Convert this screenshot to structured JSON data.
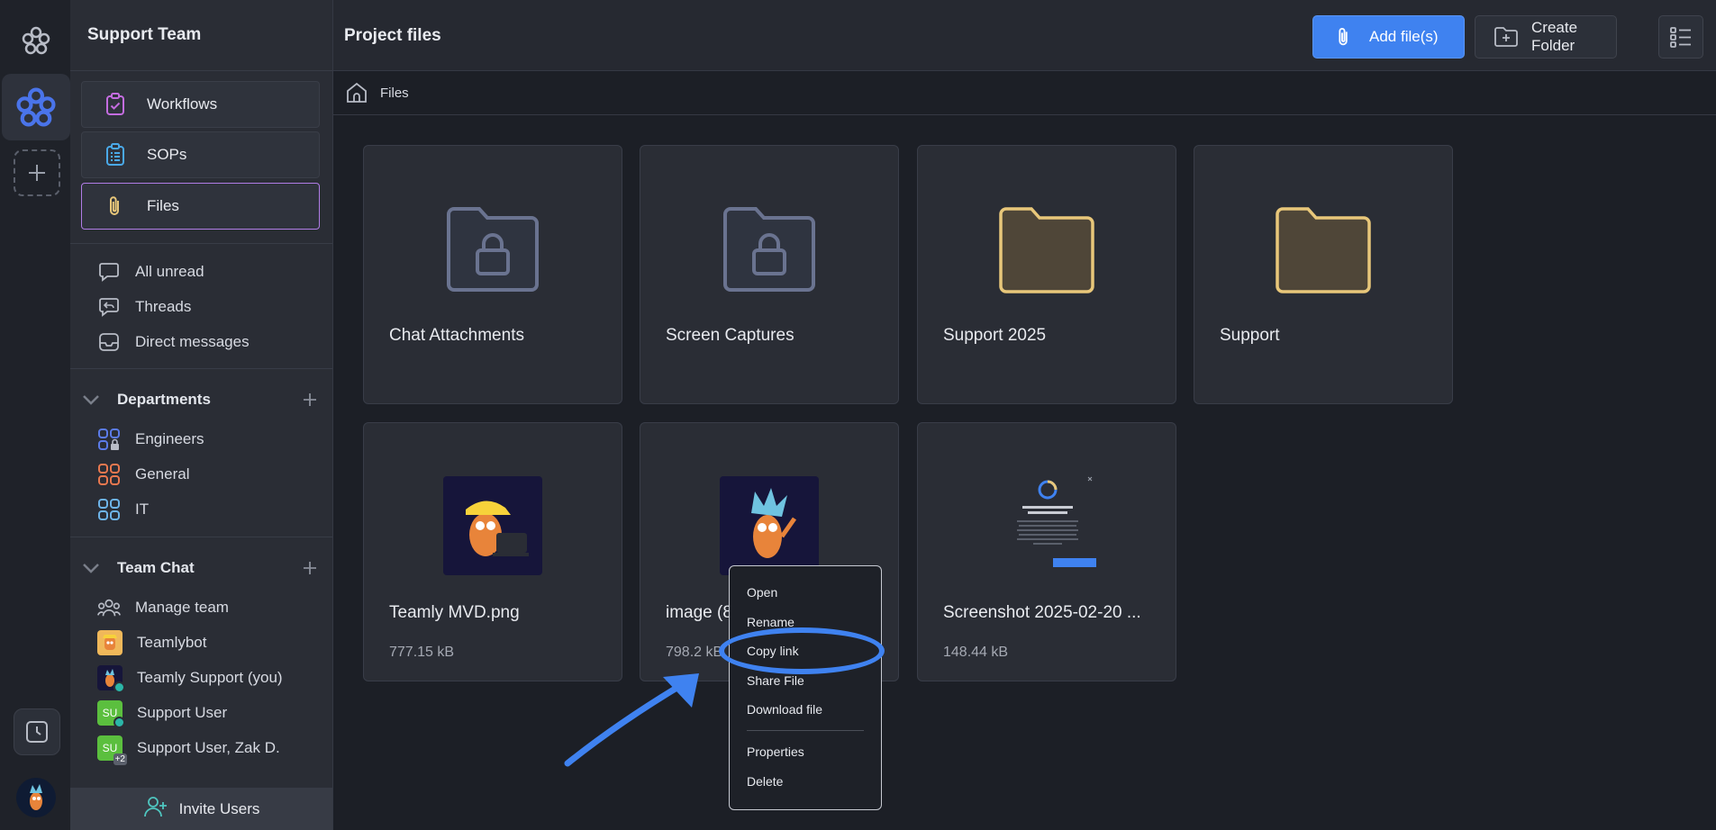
{
  "sidebar": {
    "team_name": "Support Team",
    "nav": [
      {
        "label": "Workflows",
        "icon": "clipboard-check-icon"
      },
      {
        "label": "SOPs",
        "icon": "clipboard-list-icon"
      },
      {
        "label": "Files",
        "icon": "paperclip-icon"
      }
    ],
    "inbox": [
      {
        "label": "All unread",
        "icon": "chat-bubble-icon"
      },
      {
        "label": "Threads",
        "icon": "threads-icon"
      },
      {
        "label": "Direct messages",
        "icon": "inbox-icon"
      }
    ],
    "departments": {
      "title": "Departments",
      "items": [
        {
          "label": "Engineers",
          "color": "#5b7be8"
        },
        {
          "label": "General",
          "color": "#e8784f"
        },
        {
          "label": "IT",
          "color": "#6db3e8"
        }
      ]
    },
    "team_chat": {
      "title": "Team Chat",
      "items": [
        {
          "label": "Manage team"
        },
        {
          "label": "Teamlybot"
        },
        {
          "label": "Teamly Support (you)"
        },
        {
          "label": "Support User",
          "initials": "SU"
        },
        {
          "label": "Support User, Zak D.",
          "initials": "SU",
          "badge": "+2"
        }
      ]
    },
    "invite_label": "Invite Users"
  },
  "header": {
    "title": "Project files",
    "add_files_label": "Add file(s)",
    "create_folder_label": "Create Folder"
  },
  "breadcrumb": {
    "current": "Files"
  },
  "folders": [
    {
      "name": "Chat Attachments",
      "locked": true
    },
    {
      "name": "Screen Captures",
      "locked": true
    },
    {
      "name": "Support 2025",
      "locked": false
    },
    {
      "name": "Support",
      "locked": false
    }
  ],
  "files": [
    {
      "name": "Teamly MVD.png",
      "size": "777.15 kB"
    },
    {
      "name": "image (8",
      "size": "798.2 kB"
    },
    {
      "name": "Screenshot 2025-02-20 ...",
      "size": "148.44 kB"
    }
  ],
  "context_menu": {
    "items": [
      "Open",
      "Rename",
      "Copy link",
      "Share File",
      "Download file",
      "Properties",
      "Delete"
    ],
    "highlighted": "Copy link"
  },
  "colors": {
    "accent": "#3f82f0",
    "active_border": "#b07de6",
    "folder_gold": "#e8c77a",
    "folder_locked": "#6a7390"
  }
}
